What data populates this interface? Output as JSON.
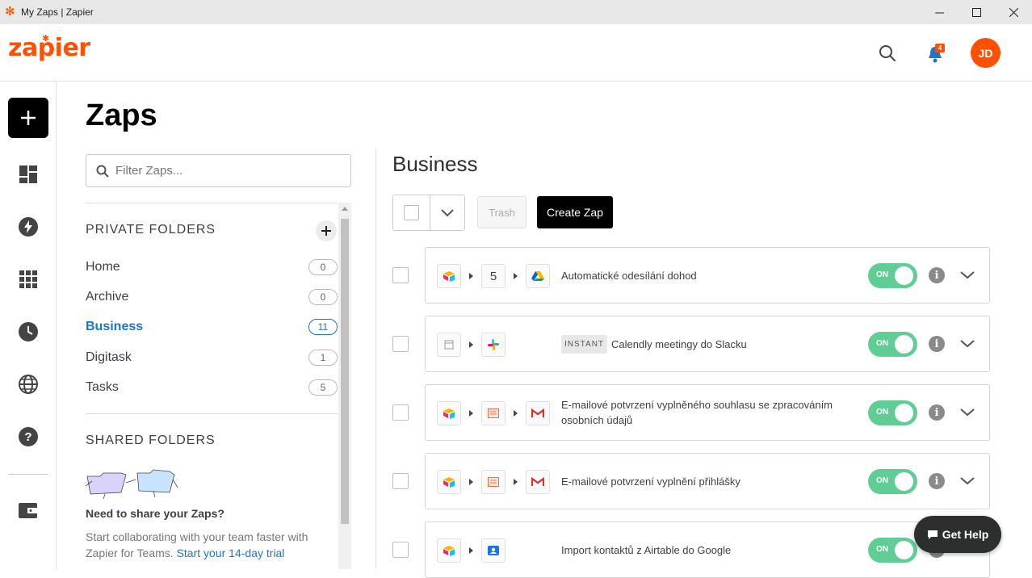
{
  "window": {
    "title": "My Zaps | Zapier",
    "controls": [
      "minimize",
      "maximize",
      "close"
    ]
  },
  "header": {
    "logo_text": "zapier",
    "notification_count": "4",
    "avatar_initials": "JD",
    "brand_color": "#ff4f00"
  },
  "sidebar": {
    "items": [
      "create-zap",
      "dashboard",
      "zaps",
      "apps",
      "history",
      "explore",
      "help",
      "billing"
    ]
  },
  "page": {
    "title": "Zaps",
    "filter_placeholder": "Filter Zaps..."
  },
  "folders": {
    "private_title": "PRIVATE FOLDERS",
    "private": [
      {
        "name": "Home",
        "count": "0",
        "active": false
      },
      {
        "name": "Archive",
        "count": "0",
        "active": false
      },
      {
        "name": "Business",
        "count": "11",
        "active": true
      },
      {
        "name": "Digitask",
        "count": "1",
        "active": false
      },
      {
        "name": "Tasks",
        "count": "5",
        "active": false
      }
    ],
    "shared_title": "SHARED FOLDERS",
    "share_title": "Need to share your Zaps?",
    "share_text": "Start collaborating with your team faster with Zapier for Teams.",
    "share_link": "Start your 14-day trial"
  },
  "main": {
    "folder_heading": "Business",
    "trash_label": "Trash",
    "create_zap_label": "Create Zap",
    "zaps": [
      {
        "name": "Automatické odesílání dohod",
        "instant": "",
        "step_count": "5",
        "status": "ON"
      },
      {
        "name": "Calendly meetingy do Slacku",
        "instant": "INSTANT",
        "step_count": "",
        "status": "ON"
      },
      {
        "name": "E-mailové potvrzení vyplněného souhlasu se zpracováním osobních údajů",
        "instant": "",
        "step_count": "",
        "status": "ON"
      },
      {
        "name": "E-mailové potvrzení vyplnění přihlášky",
        "instant": "",
        "step_count": "",
        "status": "ON"
      },
      {
        "name": "Import kontaktů z Airtable do Google",
        "instant": "",
        "step_count": "",
        "status": "ON"
      }
    ],
    "toggle_color": "#60cd95"
  },
  "help_button": "Get Help"
}
